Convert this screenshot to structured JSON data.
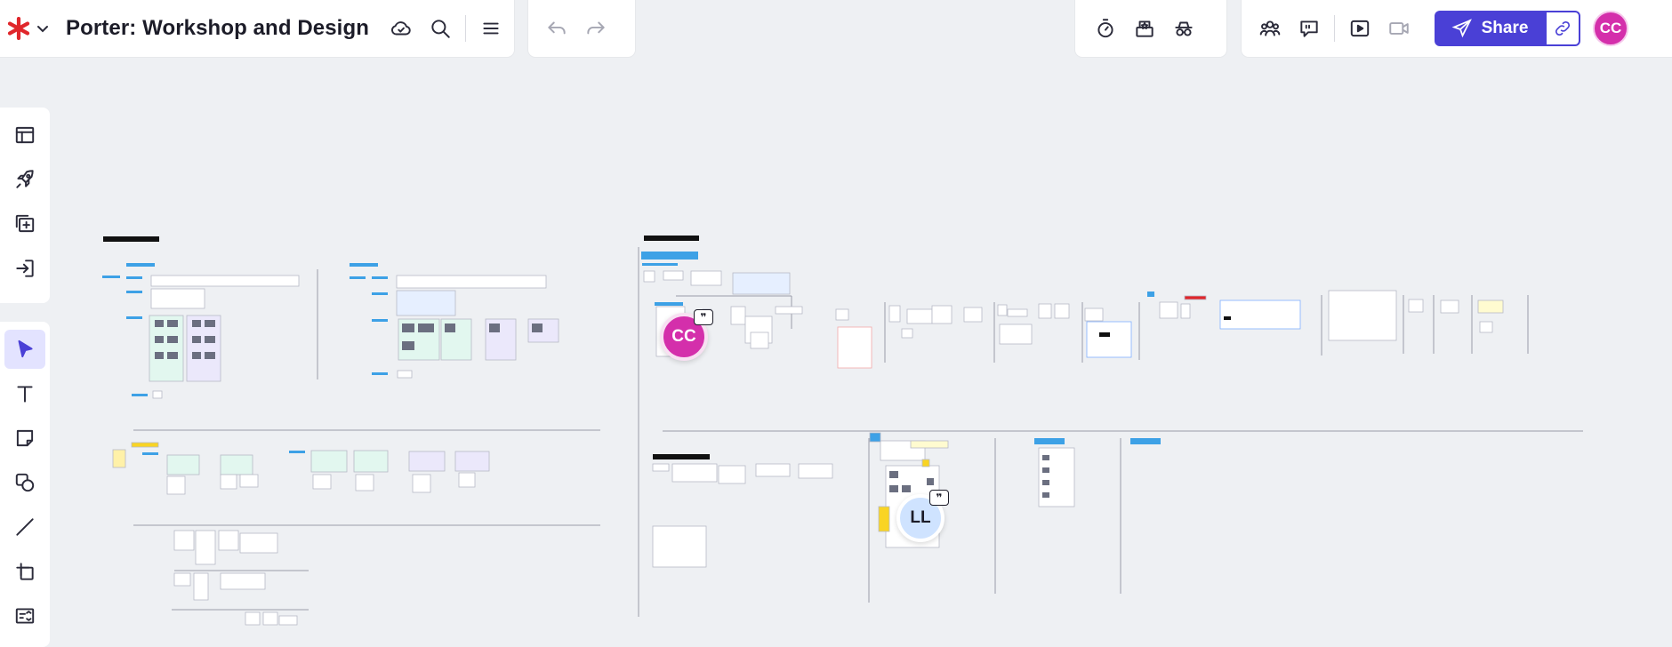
{
  "header": {
    "board_title": "Porter: Workshop and Design"
  },
  "icons": {
    "logo": "miro-asterisk-logo",
    "menu_caret": "chevron-down-icon",
    "cloud": "cloud-sync-icon",
    "search": "search-icon",
    "menu": "hamburger-menu-icon",
    "undo": "undo-icon",
    "redo": "redo-icon",
    "timer": "timer-icon",
    "vote": "voting-icon",
    "private": "private-mode-icon",
    "collaborators": "collaborators-icon",
    "comments": "comment-icon",
    "present": "present-icon",
    "video": "video-call-icon",
    "share": "paper-plane-icon",
    "copy_link": "link-icon"
  },
  "share": {
    "label": "Share"
  },
  "user": {
    "initials": "CC",
    "color": "#d42fab"
  },
  "left_toolbar": {
    "top": [
      "templates-icon",
      "rocket-icon",
      "add-frame-icon",
      "import-icon"
    ],
    "main": [
      "select-icon",
      "text-icon",
      "sticky-note-icon",
      "shapes-icon",
      "connector-line-icon",
      "frame-icon",
      "more-tools-icon"
    ]
  },
  "cursors": [
    {
      "initials": "CC",
      "color": "#d42fab",
      "badge": "❞"
    },
    {
      "initials": "LL",
      "color": "#cfe3ff",
      "badge": "❞"
    }
  ],
  "colors": {
    "accent": "#4a40d6",
    "canvas": "#eef0f3"
  }
}
